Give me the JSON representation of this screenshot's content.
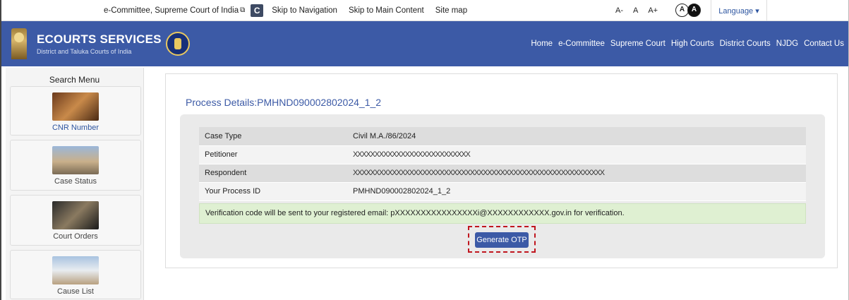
{
  "topbar": {
    "ecommittee": "e-Committee, Supreme Court of India",
    "c_label": "C",
    "skip_nav": "Skip to Navigation",
    "skip_main": "Skip to Main Content",
    "sitemap": "Site map",
    "font_small": "A-",
    "font_normal": "A",
    "font_large": "A+",
    "contrast_light": "A",
    "contrast_dark": "A",
    "language": "Language ▾"
  },
  "header": {
    "title": "ECOURTS SERVICES",
    "subtitle": "District and Taluka Courts of India",
    "nav": [
      "Home",
      "e-Committee",
      "Supreme Court",
      "High Courts",
      "District Courts",
      "NJDG",
      "Contact Us"
    ]
  },
  "sidebar": {
    "title": "Search Menu",
    "items": [
      {
        "label": "CNR Number"
      },
      {
        "label": "Case Status"
      },
      {
        "label": "Court Orders"
      },
      {
        "label": "Cause List"
      }
    ]
  },
  "main": {
    "process_title": "Process Details:PMHND090002802024_1_2",
    "rows": [
      {
        "key": "Case Type",
        "value": "Civil M.A./86/2024"
      },
      {
        "key": "Petitioner",
        "value": "XXXXXXXXXXXXXXXXXXXXXXXXXXX"
      },
      {
        "key": "Respondent",
        "value": "XXXXXXXXXXXXXXXXXXXXXXXXXXXXXXXXXXXXXXXXXXXXXXXXXXXXXXXXXX"
      },
      {
        "key": "Your Process ID",
        "value": "PMHND090002802024_1_2"
      }
    ],
    "notice": "Verification code will be sent to your registered email: pXXXXXXXXXXXXXXXXi@XXXXXXXXXXXX.gov.in for verification.",
    "otp_button": "Generate OTP"
  },
  "colors": {
    "header_bg": "#3c5aa6",
    "highlight": "#c0161e",
    "notice_bg": "#dff0d2"
  }
}
